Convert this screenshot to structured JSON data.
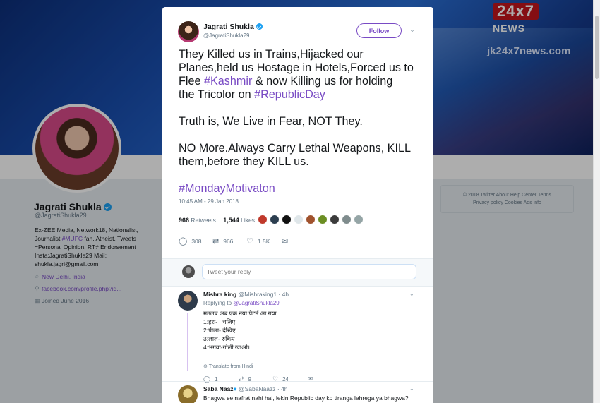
{
  "banner": {
    "logo_number": "24x7",
    "logo_word": "NEWS",
    "site": "jk24x7news.com"
  },
  "profile": {
    "name": "Jagrati Shukla",
    "handle": "@JagratiShukla29",
    "bio_1": "Ex-ZEE Media, Network18, Nationalist,",
    "bio_2a": "Journalist ",
    "bio_2b": "#MUFC",
    "bio_2c": " fan, Atheist. Tweets",
    "bio_3": "=Personal Opinion, RT≠ Endorsement",
    "bio_4": "Insta:JagratiShukla29 Mail:",
    "bio_5": "shukla.jagri@gmail.com",
    "location": "New Delhi, India",
    "website": "facebook.com/profile.php?id...",
    "joined": "Joined June 2016"
  },
  "footer": {
    "line1": "© 2018 Twitter   About   Help Center   Terms",
    "line2": "Privacy policy   Cookies   Ads info"
  },
  "tweet": {
    "author_name": "Jagrati Shukla",
    "author_handle": "@JagratiShukla29",
    "follow_label": "Follow",
    "line1": "They Killed us in Trains,Hijacked our",
    "line2": "Planes,held us Hostage in Hotels,Forced us to",
    "line3a": "Flee ",
    "line3b": "#Kashmir",
    "line3c": " & now Killing us for holding",
    "line4a": "the Tricolor on ",
    "line4b": "#RepublicDay",
    "line5": "Truth is, We Live in Fear, NOT They.",
    "line6": "NO More.Always Carry Lethal Weapons, KILL",
    "line7": "them,before they KILL us.",
    "hashtag_final": "#MondayMotivaton",
    "timestamp": "10:45 AM - 29 Jan 2018",
    "retweets_count": "966",
    "retweets_label": "Retweets",
    "likes_count": "1,544",
    "likes_label": "Likes",
    "reply_count": "308",
    "retweet_count": "966",
    "like_count": "1.5K"
  },
  "reply_box": {
    "placeholder": "Tweet your reply"
  },
  "replies": [
    {
      "name": "Mishra king",
      "handle": "@Mishraking1 · 4h",
      "replying_prefix": "Replying to ",
      "replying_to": "@JagratiShukla29",
      "body_1": "मतलब अब एक नया पैटर्न आ गया....",
      "body_2": "1:हरा-   चलिए",
      "body_3": "2:पीला- देखिए",
      "body_4": "3:लाल- रुकिए",
      "body_5": "4:भगवा-गोली खाओ।",
      "translate": "Translate from Hindi",
      "reply_count": "1",
      "retweet_count": "9",
      "like_count": "24"
    },
    {
      "name": "Saba Naaz",
      "handle": "@SabaNaazz · 4h",
      "body_1": "Bhagwa se nafrat nahi hai, lekin Republic day ko tiranga lehrega ya bhagwa?"
    }
  ],
  "icons": {
    "verified": "verified-badge-icon",
    "reply": "reply-icon",
    "retweet": "retweet-icon",
    "like": "heart-icon",
    "dm": "envelope-icon",
    "location": "location-pin-icon",
    "link": "link-icon",
    "calendar": "calendar-icon"
  },
  "colors": {
    "accent": "#794bc4",
    "verified": "#1da1f2",
    "muted": "#657786"
  }
}
